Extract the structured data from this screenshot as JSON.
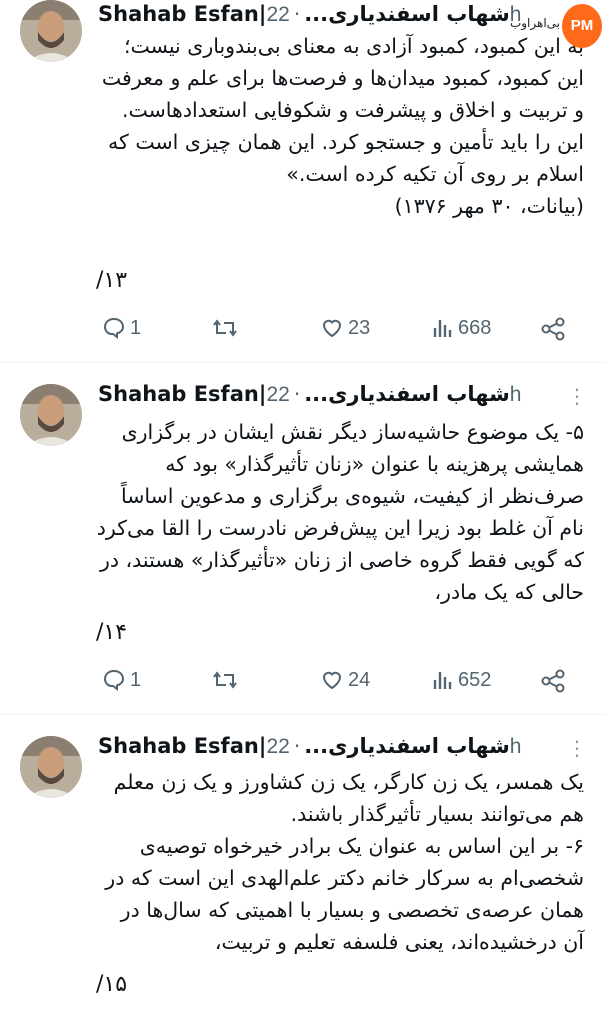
{
  "tweets": [
    {
      "author": "Shahab Esfan|شهاب اسفندیاری...",
      "time": "22h",
      "text": "به این کمبود، کمبود آزادی به معنای بی‌بندوباری نیست؛ این کمبود، کمبود میدان‌ها و فرصت‌ها برای علم و معرفت و تربیت و اخلاق و پیشرفت و شکوفایی استعدادهاست. این را باید تأمین و جستجو کرد. این همان چیزی است که اسلام بر روی آن تکیه کرده است.»",
      "source": "(بیانات، ۳۰ مهر ۱۳۷۶)",
      "number": "/۱۳",
      "replies": "1",
      "likes": "23",
      "views": "668"
    },
    {
      "author": "Shahab Esfan|شهاب اسفندیاری...",
      "time": "22h",
      "text": "۵- یک موضوع حاشیه‌ساز دیگر نقش ایشان در برگزاری همایشی پرهزینه با عنوان «زنان تأثیرگذار» بود که صرف‌نظر از کیفیت، شیوه‌ی برگزاری و مدعوین اساساً نام آن غلط بود زیرا این پیش‌فرض نادرست را القا می‌کرد که گویی فقط گروه خاصی از زنان «تأثیرگذار» هستند، در حالی که یک مادر،",
      "number": "/۱۴",
      "replies": "1",
      "likes": "24",
      "views": "652"
    },
    {
      "author": "Shahab Esfan|شهاب اسفندیاری...",
      "time": "22h",
      "text1": "یک همسر، یک زن کارگر، یک زن کشاورز و یک زن معلم هم می‌توانند بسیار تأثیرگذار باشند.",
      "text2": "۶- بر این اساس به عنوان یک برادر خیرخواه توصیه‌ی شخصی‌ام به سرکار خانم دکتر علم‌الهدی این است که در همان عرصه‌ی تخصصی و بسیار با اهمیتی که سال‌ها در آن درخشیده‌اند، یعنی فلسفه تعلیم و تربیت،",
      "number": "/۱۵"
    }
  ],
  "watermark": {
    "text": "بی‌اهراوب",
    "brand": "PM"
  },
  "colors": {
    "secondary": "#536471",
    "badge": "#ff6a1a"
  }
}
